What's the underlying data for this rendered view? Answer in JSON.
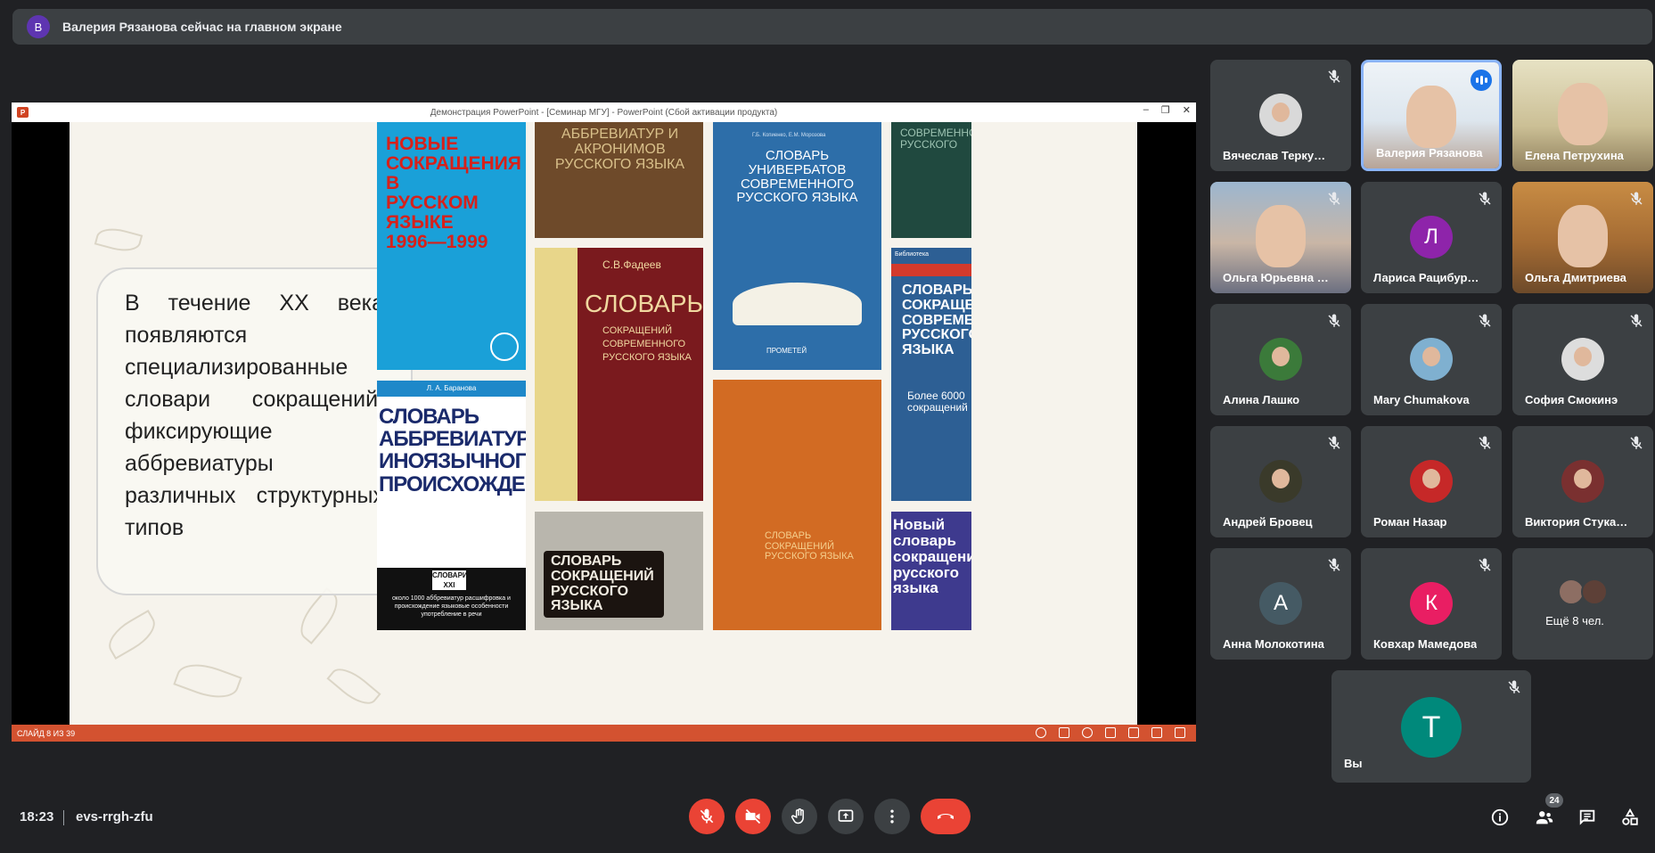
{
  "banner": {
    "avatar_letter": "В",
    "text": "Валерия Рязанова сейчас на главном экране"
  },
  "presentation": {
    "window_title": "Демонстрация PowerPoint - [Семинар МГУ] - PowerPoint (Сбой активации продукта)",
    "slide_text": "В течение ХХ века появляются специализированные словари сокращений, фиксирующие аббревиатуры различных структурных типов",
    "slide_counter": "СЛАЙД 8 ИЗ 39",
    "books": {
      "b1_title": "НОВЫЕ СОКРАЩЕНИЯ В РУССКОМ ЯЗЫКЕ 1996—1999",
      "b2_title": "АББРЕВИАТУР И АКРОНИМОВ РУССКОГО ЯЗЫКА",
      "b3_authors": "Г.Б. Копиенко, Е.М. Морозова",
      "b3_title": "СЛОВАРЬ УНИВЕРБАТОВ СОВРЕМЕННОГО РУССКОГО ЯЗЫКА",
      "b3_publisher": "ПРОМЕТЕЙ",
      "b4_title": "СОВРЕМЕННОГО РУССКОГО",
      "b5_author": "С.В.Фадеев",
      "b5_title": "СЛОВАРЬ",
      "b5_subtitle": "СОКРАЩЕНИЙ СОВРЕМЕННОГО РУССКОГО ЯЗЫКА",
      "b6_author": "Л. А. Баранова",
      "b6_title": "СЛОВАРЬ АББРЕВИАТУР ИНОЯЗЫЧНОГО ПРОИСХОЖДЕНИЯ",
      "b6_series": "СЛОВАРИ XXI",
      "b6_note": "около 1000 аббревиатур расшифровка и происхождение языковые особенности употребление в речи",
      "b7_title": "СЛОВАРЬ СОКРАЩЕНИЙ РУССКОГО ЯЗЫКА",
      "b8_title": "СЛОВАРЬ СОКРАЩЕНИЙ РУССКОГО ЯЗЫКА",
      "b9_header": "Библиотека",
      "b9_title": "СЛОВАРЬ СОКРАЩЕНИЙ СОВРЕМЕННОГО РУССКОГО ЯЗЫКА",
      "b9_note": "Более 6000 сокращений",
      "b10_title": "Новый словарь сокращений русского языка"
    }
  },
  "participants": [
    {
      "name": "Вячеслав Терку…",
      "type": "photo",
      "muted": true
    },
    {
      "name": "Валерия Рязанова",
      "type": "video",
      "speaking": true
    },
    {
      "name": "Елена Петрухина",
      "type": "video",
      "muted": false
    },
    {
      "name": "Ольга Юрьевна …",
      "type": "video",
      "muted": true
    },
    {
      "name": "Лариса Рацибур…",
      "type": "letter",
      "letter": "Л",
      "color": "#8e24aa",
      "muted": true
    },
    {
      "name": "Ольга Дмитриева",
      "type": "video",
      "muted": true
    },
    {
      "name": "Алина Лашко",
      "type": "photo",
      "muted": true
    },
    {
      "name": "Mary Chumakova",
      "type": "photo",
      "muted": true
    },
    {
      "name": "София Смокинэ",
      "type": "photo",
      "muted": true
    },
    {
      "name": "Андрей Бровец",
      "type": "photo",
      "muted": true
    },
    {
      "name": "Роман Назар",
      "type": "photo",
      "muted": true
    },
    {
      "name": "Виктория Стука…",
      "type": "photo",
      "muted": true
    },
    {
      "name": "Анна Молокотина",
      "type": "letter",
      "letter": "А",
      "color": "#455a64",
      "muted": true
    },
    {
      "name": "Ковхар Мамедова",
      "type": "letter",
      "letter": "К",
      "color": "#e91e63",
      "muted": true
    },
    {
      "name": "Ещё 8 чел.",
      "type": "more"
    },
    {
      "name": "Вы",
      "type": "letter",
      "letter": "Т",
      "color": "#00897b",
      "muted": true
    }
  ],
  "bottom": {
    "time": "18:23",
    "meeting_code": "evs-rrgh-zfu",
    "participants_count": "24"
  },
  "colors": {
    "accent": "#8ab4f8",
    "danger": "#ea4335",
    "surface": "#3c4043",
    "background": "#202124"
  }
}
